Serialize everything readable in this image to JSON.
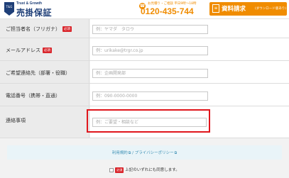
{
  "header": {
    "logo_tag": "Trust & Growth",
    "logo_name": "売掛保証",
    "logo_badge_text": "T&G",
    "phone_hours": "お見積り・ご相談 平日9時～18時",
    "phone_number": "0120-435-744",
    "download_button_label": "資料請求",
    "download_button_sub": "(ダウンロード版あり)"
  },
  "form": {
    "required_label": "必須",
    "rows": [
      {
        "label": "ご担当者名（フリガナ）",
        "required": true,
        "placeholder": "例：ヤマダ　タロウ"
      },
      {
        "label": "メールアドレス",
        "required": true,
        "placeholder": "例：urikake@trgr.co.jp"
      },
      {
        "label": "ご希望連絡先（部署・役職）",
        "required": false,
        "placeholder": "例：企画開発部"
      },
      {
        "label": "電話番号（携帯・直通）",
        "required": false,
        "placeholder": "例：090-0000-0000"
      },
      {
        "label": "連絡事項",
        "required": false,
        "placeholder": "例：ご要望・相談など"
      }
    ]
  },
  "footer": {
    "terms_link": "利用規約",
    "separator": "/",
    "privacy_link": "プライバシーポリシー",
    "agree_text": "上記のいずれにも同意します。"
  },
  "colors": {
    "accent": "#f08c00",
    "brand": "#1f3f78",
    "required_badge": "#d9262c",
    "highlight": "#e0161c",
    "link": "#3b8fb4"
  }
}
